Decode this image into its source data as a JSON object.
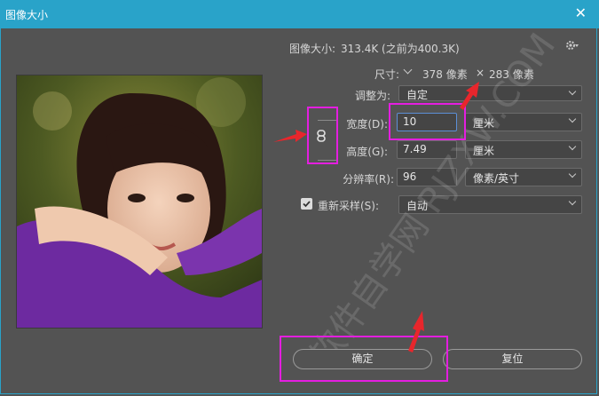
{
  "window": {
    "title": "图像大小",
    "close_glyph": "✕"
  },
  "image_size": {
    "label": "图像大小:",
    "value": "313.4K (之前为400.3K)"
  },
  "dimensions": {
    "label": "尺寸:",
    "width": "378 像素",
    "times": "×",
    "height": "283 像素"
  },
  "fit_to": {
    "label": "调整为:",
    "value": "自定"
  },
  "width": {
    "label": "宽度(D):",
    "value": "10",
    "unit": "厘米"
  },
  "height": {
    "label": "高度(G):",
    "value": "7.49",
    "unit": "厘米"
  },
  "resolution": {
    "label": "分辨率(R):",
    "value": "96",
    "unit": "像素/英寸"
  },
  "resample": {
    "label": "重新采样(S):",
    "checked": true,
    "value": "自动"
  },
  "buttons": {
    "ok": "确定",
    "reset": "复位"
  },
  "watermark": "软件自学网 RJZXW.COM",
  "colors": {
    "titlebar": "#29a3c9",
    "dialog_bg": "#535353",
    "highlight": "#e41ee0",
    "arrow": "#e8262c"
  },
  "icons": [
    "gear-icon",
    "chevron-down-icon",
    "link-icon",
    "close-icon"
  ]
}
